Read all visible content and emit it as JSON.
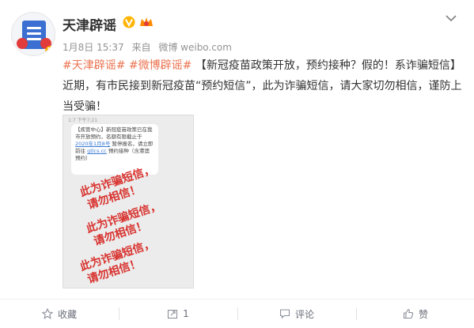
{
  "header": {
    "user_name": "天津辟谣",
    "date": "1月8日 15:37",
    "source_prefix": "来自",
    "source": "微博 weibo.com"
  },
  "post": {
    "tags": [
      "#天津辟谣#",
      "#微博辟谣#"
    ],
    "title": "【新冠疫苗政策开放，预约接种？假的！系诈骗短信】",
    "body": "近期，有市民接到新冠疫苗“预约短信”，此为诈骗短信，请大家切勿相信，谨防上当受骗！"
  },
  "image": {
    "status_bar": "1:7 下午7:21",
    "sms_text_1": "【疾管中心】新冠疫苗政策已在我市开放预约，名额有限截止于",
    "sms_date": "2020年1月8号",
    "sms_text_2": "暂停报名，请立即前往",
    "sms_link": "gtlcs.cc",
    "sms_text_3": "预约接种（含港澳预约）",
    "stamp_line1": "此为诈骗短信，",
    "stamp_line2": "请勿相信！"
  },
  "actions": {
    "favorite_label": "收藏",
    "repost_count": "1",
    "comment_label": "评论",
    "like_label": "赞"
  },
  "colors": {
    "tag": "#eb7350",
    "stamp": "#d8332f",
    "text": "#333333",
    "meta": "#939393"
  }
}
